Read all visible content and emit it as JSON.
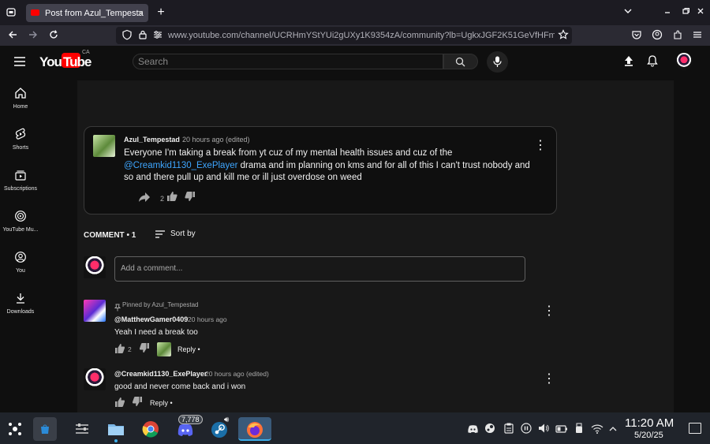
{
  "browser": {
    "tab_title": "Post from Azul_Tempesta",
    "url": "www.youtube.com/channel/UCRHmYStYUi2gUXy1K9354zA/community?lb=UgkxJGF2K51GeVfHFm"
  },
  "youtube": {
    "logo_text": "YouTube",
    "country": "CA",
    "search_placeholder": "Search"
  },
  "sidebar": {
    "items": [
      {
        "label": "Home",
        "icon": "home-icon"
      },
      {
        "label": "Shorts",
        "icon": "shorts-icon"
      },
      {
        "label": "Subscriptions",
        "icon": "subscriptions-icon"
      },
      {
        "label": "YouTube Mu...",
        "icon": "youtube-music-icon"
      },
      {
        "label": "You",
        "icon": "you-icon"
      },
      {
        "label": "Downloads",
        "icon": "download-icon"
      }
    ]
  },
  "post": {
    "author": "Azul_Tempestad",
    "time": "20 hours ago (edited)",
    "text_before": "Everyone I'm taking a break from yt cuz of my mental health issues and cuz of the",
    "mention": "@Creamkid1130_ExePlayer",
    "text_after": " drama and im planning on kms and for all of this I can't trust nobody and so and there pull up and kill me or ill just overdose on weed",
    "likes": "2"
  },
  "comments_section": {
    "count_label": "COMMENT • 1",
    "sort_label": "Sort by",
    "add_placeholder": "Add a comment..."
  },
  "comments": [
    {
      "pinned_label": "Pinned by Azul_Tempestad",
      "author": "@MatthewGamer0409",
      "time": "20 hours ago",
      "text": "Yeah I need a break too",
      "likes": "2",
      "reply_label": "Reply •"
    },
    {
      "author": "@Creamkid1130_ExePlayer",
      "time": "20 hours ago (edited)",
      "text": "good and never come back and i won",
      "reply_label": "Reply •"
    }
  ],
  "taskbar": {
    "discord_badge": "7,778",
    "time": "11:20 AM",
    "date": "5/20/25"
  },
  "colors": {
    "youtube_red": "#ff0000",
    "link_blue": "#3ea6ff",
    "bg_dark": "#0f0f0f"
  }
}
